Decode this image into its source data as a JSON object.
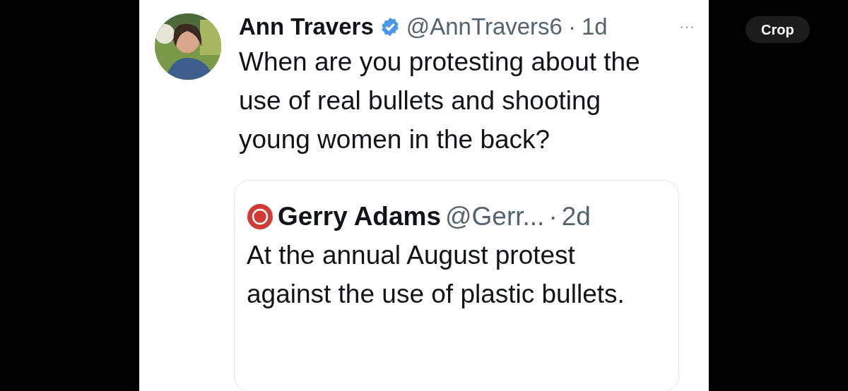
{
  "tweet": {
    "author": "Ann Travers",
    "verified": true,
    "handle": "@AnnTravers6",
    "separator": "·",
    "time": "1d",
    "more": "···",
    "text": "When are you protesting about the use of real bullets and shooting young women in the back?",
    "quote": {
      "author": "Gerry Adams",
      "handle": "@Gerr...",
      "separator": "·",
      "time": "2d",
      "text": "At the annual August protest against the use of plastic bullets."
    }
  },
  "crop_button": "Crop"
}
